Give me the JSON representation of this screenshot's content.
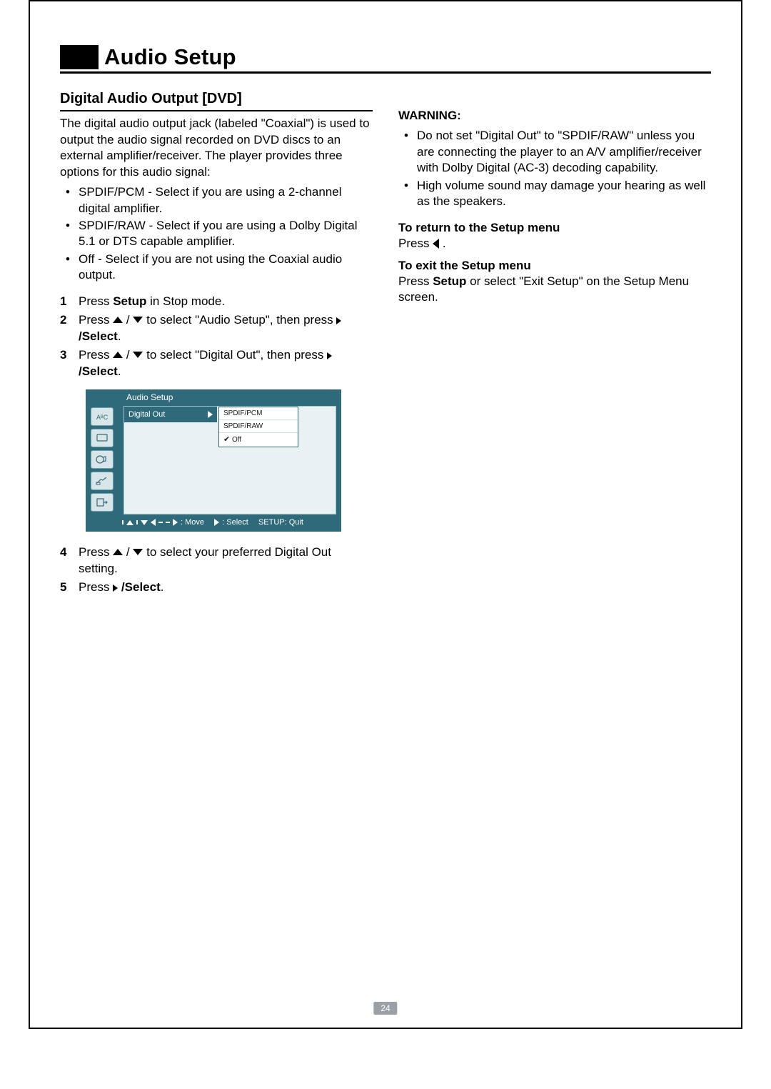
{
  "pageTitle": "Audio Setup",
  "pageNumber": "24",
  "left": {
    "heading": "Digital Audio Output [DVD]",
    "intro": "The digital audio output jack (labeled \"Coaxial\") is used to output the audio signal recorded on DVD discs to an external amplifier/receiver. The player provides three options for this audio signal:",
    "options": [
      "SPDIF/PCM - Select if you are using a 2-channel digital amplifier.",
      "SPDIF/RAW - Select if you are using a Dolby Digital 5.1 or DTS capable amplifier.",
      "Off - Select if you are not using the Coaxial audio output."
    ],
    "steps": [
      {
        "num": "1",
        "pre": "Press ",
        "bold1": "Setup",
        "post1": " in Stop mode."
      },
      {
        "num": "2",
        "pre": "Press ",
        "mid": " to select \"Audio Setup\", then press ",
        "select": "/Select",
        "post": "."
      },
      {
        "num": "3",
        "pre": "Press ",
        "mid": " to select \"Digital Out\", then press ",
        "select": "/Select",
        "post": "."
      }
    ],
    "steps2": [
      {
        "num": "4",
        "pre": "Press ",
        "mid": " to select your preferred Digital Out setting."
      },
      {
        "num": "5",
        "pre": "Press ",
        "select": "/Select",
        "post": "."
      }
    ]
  },
  "osd": {
    "title": "Audio Setup",
    "item": "Digital Out",
    "popup": [
      "SPDIF/PCM",
      "SPDIF/RAW",
      "Off"
    ],
    "checkedIndex": 2,
    "footer": {
      "move": ": Move",
      "select": ": Select",
      "quit": "SETUP: Quit"
    }
  },
  "right": {
    "warningLabel": "WARNING:",
    "warnings": [
      "Do not set \"Digital Out\" to \"SPDIF/RAW\" unless you are connecting the player to an A/V amplifier/receiver with Dolby Digital (AC-3) decoding capability.",
      "High volume sound may damage your hearing as well as the speakers."
    ],
    "returnHead": "To return to the Setup menu",
    "returnBody": "Press ",
    "returnPost": " .",
    "exitHead": "To exit the Setup menu",
    "exitBody1": "Press ",
    "exitBold": "Setup",
    "exitBody2": " or select \"Exit Setup\" on the Setup Menu screen."
  }
}
